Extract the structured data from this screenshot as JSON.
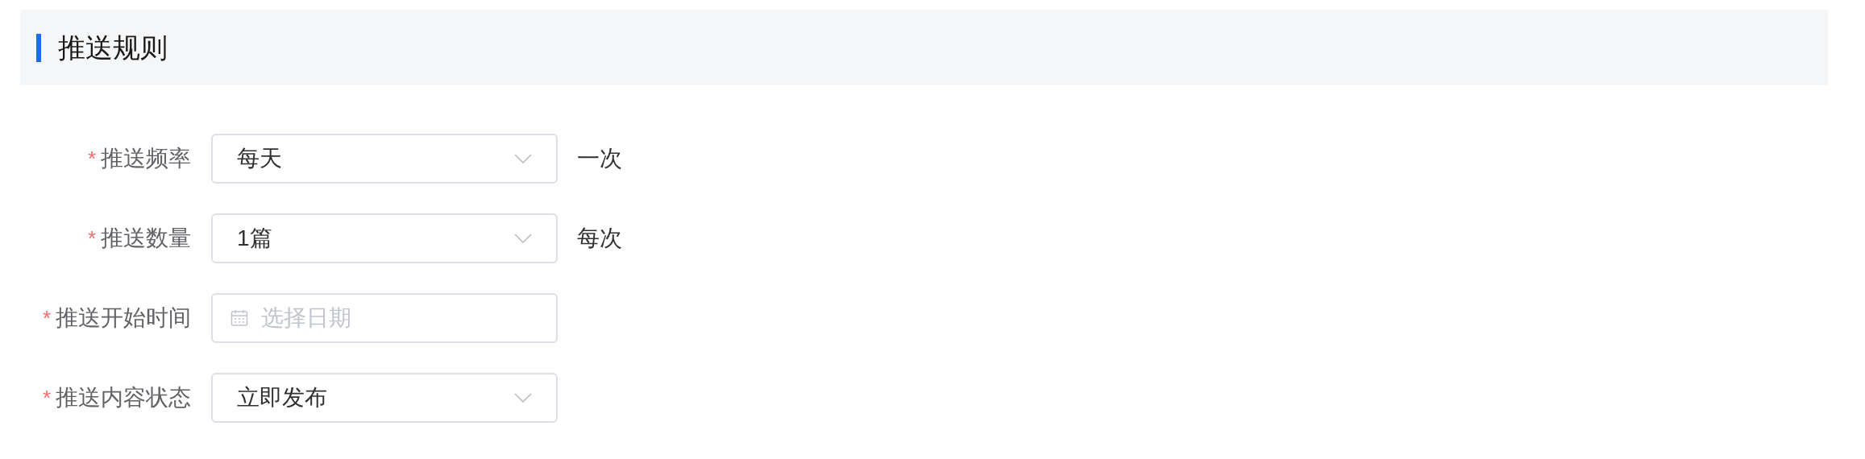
{
  "section": {
    "title": "推送规则"
  },
  "fields": [
    {
      "kind": "select",
      "required_mark": "*",
      "label": "推送频率",
      "value": "每天",
      "suffix": "一次"
    },
    {
      "kind": "select",
      "required_mark": "*",
      "label": "推送数量",
      "value": "1篇",
      "suffix": "每次"
    },
    {
      "kind": "date",
      "required_mark": "*",
      "label": "推送开始时间",
      "placeholder": "选择日期"
    },
    {
      "kind": "select",
      "required_mark": "*",
      "label": "推送内容状态",
      "value": "立即发布"
    }
  ]
}
